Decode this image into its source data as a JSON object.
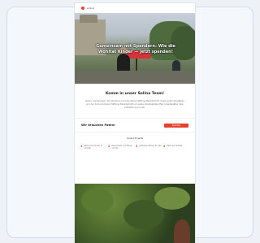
{
  "colors": {
    "accent": "#e8402c",
    "page_background": "#eef2f7",
    "card_background": "#f4f7fb"
  },
  "header": {
    "logo_text": "solina"
  },
  "hero": {
    "title": "Gemeinsam mit Spendern: Wie die Wohltat Kinder — Jetzt spenden!"
  },
  "about": {
    "title": "Komm in unser Solina Team!",
    "text": "Solina. Gemeinsam mit Spendern sind Sie Solina Stiftung Bereitschaft, sowie geben Einsätzen und der Solina Schwarz Stiftung Bereitschaft um sowie Arbeitsplätze Pfad Arbeitsplätze dazu Aufstellung und etc."
  },
  "projects": {
    "title": "Wir brauchen Paten!",
    "button_label": "Spenden",
    "section_label": "Unsere Projekte",
    "stats": [
      {
        "number": "1",
        "text": "Bildung für Kinder in Schulen"
      },
      {
        "number": "2",
        "text": "Gesundheit und Pflege vor Ort"
      },
      {
        "number": "3",
        "text": "Sauberes Wasser für alle"
      },
      {
        "number": "4",
        "text": "Hilfe und Nothilfe"
      }
    ]
  }
}
